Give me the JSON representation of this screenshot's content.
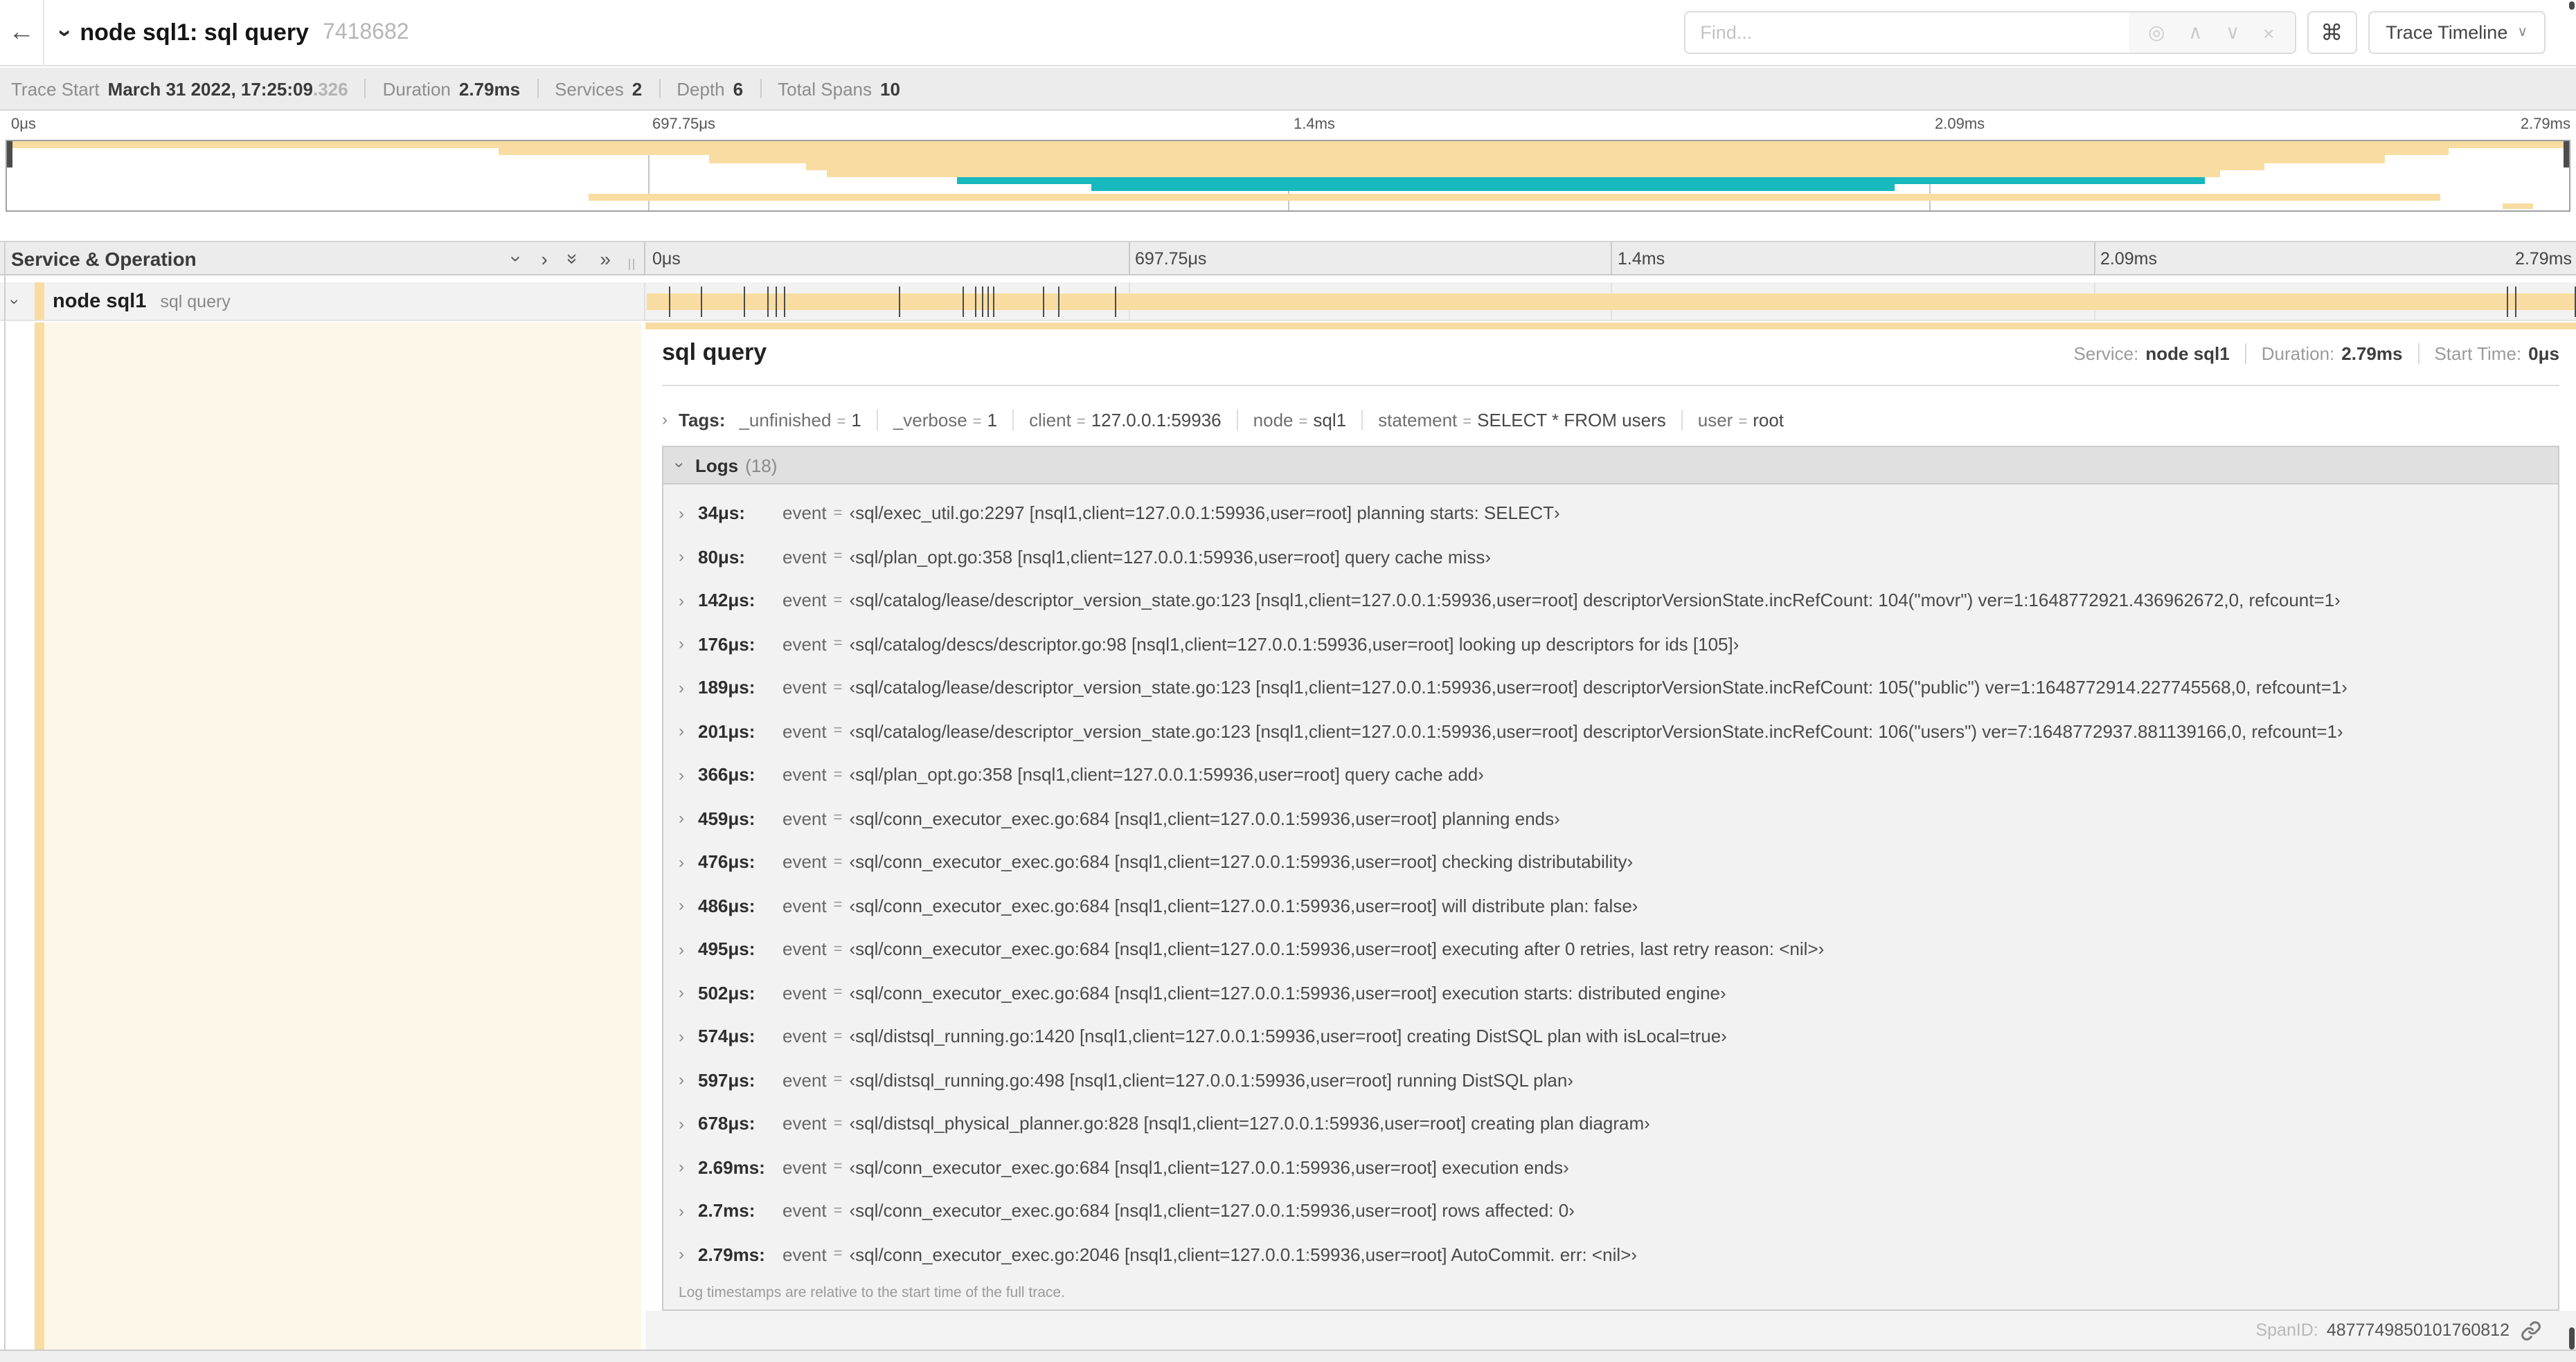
{
  "colors": {
    "service_node_sql1": "#F8DCA1",
    "service_other": "#17B8BE",
    "cream_tint": "rgba(248,220,161,0.24)"
  },
  "header": {
    "back": "←",
    "title": "node sql1: sql query",
    "trace_id": "7418682",
    "find_placeholder": "Find...",
    "cmd_label": "⌘",
    "view_dropdown_label": "Trace Timeline"
  },
  "meta_items": [
    {
      "label": "Trace Start",
      "value": "March 31 2022, 17:25:09",
      "suffix": ".326"
    },
    {
      "label": "Duration",
      "value": "2.79ms"
    },
    {
      "label": "Services",
      "value": "2"
    },
    {
      "label": "Depth",
      "value": "6"
    },
    {
      "label": "Total Spans",
      "value": "10"
    }
  ],
  "time_ticks": [
    "0μs",
    "697.75μs",
    "1.4ms",
    "2.09ms",
    "2.79ms"
  ],
  "minimap_rows": [
    {
      "start": 0.0,
      "end": 1.0,
      "service": "node_sql1",
      "row": 0
    },
    {
      "start": 0.192,
      "end": 0.953,
      "service": "node_sql1",
      "row": 1
    },
    {
      "start": 0.274,
      "end": 0.928,
      "service": "node_sql1",
      "row": 2
    },
    {
      "start": 0.312,
      "end": 0.881,
      "service": "node_sql1",
      "row": 3
    },
    {
      "start": 0.32,
      "end": 0.864,
      "service": "node_sql1",
      "row": 4
    },
    {
      "start": 0.371,
      "end": 0.858,
      "service": "other",
      "row": 5
    },
    {
      "start": 0.423,
      "end": 0.737,
      "service": "other",
      "row": 6
    },
    {
      "start": 0.227,
      "end": 0.95,
      "service": "node_sql1",
      "row": 7.3
    },
    {
      "start": 0.974,
      "end": 0.986,
      "service": "node_sql1",
      "row": 8.6
    }
  ],
  "tree": {
    "header": "Service & Operation",
    "row": {
      "service": "node sql1",
      "operation": "sql query"
    }
  },
  "trace_duration_us": 2790,
  "span_log_marker_times_us": [
    34,
    80,
    142,
    176,
    189,
    201,
    366,
    459,
    476,
    486,
    495,
    502,
    574,
    597,
    678,
    2690,
    2702,
    2788
  ],
  "detail": {
    "operation": "sql query",
    "meta": [
      {
        "label": "Service:",
        "value": "node sql1"
      },
      {
        "label": "Duration:",
        "value": "2.79ms"
      },
      {
        "label": "Start Time:",
        "value": "0μs"
      }
    ],
    "tags_label": "Tags:",
    "tags": [
      {
        "key": "_unfinished",
        "value": "1"
      },
      {
        "key": "_verbose",
        "value": "1"
      },
      {
        "key": "client",
        "value": "127.0.0.1:59936"
      },
      {
        "key": "node",
        "value": "sql1"
      },
      {
        "key": "statement",
        "value": "SELECT * FROM users"
      },
      {
        "key": "user",
        "value": "root"
      }
    ],
    "logs_label": "Logs",
    "logs_count": "(18)",
    "logs": [
      {
        "time": "34μs:",
        "field": "event",
        "value": "‹sql/exec_util.go:2297 [nsql1,client=127.0.0.1:59936,user=root] planning starts: SELECT›"
      },
      {
        "time": "80μs:",
        "field": "event",
        "value": "‹sql/plan_opt.go:358 [nsql1,client=127.0.0.1:59936,user=root] query cache miss›"
      },
      {
        "time": "142μs:",
        "field": "event",
        "value": "‹sql/catalog/lease/descriptor_version_state.go:123 [nsql1,client=127.0.0.1:59936,user=root] descriptorVersionState.incRefCount: 104(\"movr\") ver=1:1648772921.436962672,0, refcount=1›"
      },
      {
        "time": "176μs:",
        "field": "event",
        "value": "‹sql/catalog/descs/descriptor.go:98 [nsql1,client=127.0.0.1:59936,user=root] looking up descriptors for ids [105]›"
      },
      {
        "time": "189μs:",
        "field": "event",
        "value": "‹sql/catalog/lease/descriptor_version_state.go:123 [nsql1,client=127.0.0.1:59936,user=root] descriptorVersionState.incRefCount: 105(\"public\") ver=1:1648772914.227745568,0, refcount=1›"
      },
      {
        "time": "201μs:",
        "field": "event",
        "value": "‹sql/catalog/lease/descriptor_version_state.go:123 [nsql1,client=127.0.0.1:59936,user=root] descriptorVersionState.incRefCount: 106(\"users\") ver=7:1648772937.881139166,0, refcount=1›"
      },
      {
        "time": "366μs:",
        "field": "event",
        "value": "‹sql/plan_opt.go:358 [nsql1,client=127.0.0.1:59936,user=root] query cache add›"
      },
      {
        "time": "459μs:",
        "field": "event",
        "value": "‹sql/conn_executor_exec.go:684 [nsql1,client=127.0.0.1:59936,user=root] planning ends›"
      },
      {
        "time": "476μs:",
        "field": "event",
        "value": "‹sql/conn_executor_exec.go:684 [nsql1,client=127.0.0.1:59936,user=root] checking distributability›"
      },
      {
        "time": "486μs:",
        "field": "event",
        "value": "‹sql/conn_executor_exec.go:684 [nsql1,client=127.0.0.1:59936,user=root] will distribute plan: false›"
      },
      {
        "time": "495μs:",
        "field": "event",
        "value": "‹sql/conn_executor_exec.go:684 [nsql1,client=127.0.0.1:59936,user=root] executing after 0 retries, last retry reason: <nil>›"
      },
      {
        "time": "502μs:",
        "field": "event",
        "value": "‹sql/conn_executor_exec.go:684 [nsql1,client=127.0.0.1:59936,user=root] execution starts: distributed engine›"
      },
      {
        "time": "574μs:",
        "field": "event",
        "value": "‹sql/distsql_running.go:1420 [nsql1,client=127.0.0.1:59936,user=root] creating DistSQL plan with isLocal=true›"
      },
      {
        "time": "597μs:",
        "field": "event",
        "value": "‹sql/distsql_running.go:498 [nsql1,client=127.0.0.1:59936,user=root] running DistSQL plan›"
      },
      {
        "time": "678μs:",
        "field": "event",
        "value": "‹sql/distsql_physical_planner.go:828 [nsql1,client=127.0.0.1:59936,user=root] creating plan diagram›"
      },
      {
        "time": "2.69ms:",
        "field": "event",
        "value": "‹sql/conn_executor_exec.go:684 [nsql1,client=127.0.0.1:59936,user=root] execution ends›"
      },
      {
        "time": "2.7ms:",
        "field": "event",
        "value": "‹sql/conn_executor_exec.go:684 [nsql1,client=127.0.0.1:59936,user=root] rows affected: 0›"
      },
      {
        "time": "2.79ms:",
        "field": "event",
        "value": "‹sql/conn_executor_exec.go:2046 [nsql1,client=127.0.0.1:59936,user=root] AutoCommit. err: <nil>›"
      }
    ],
    "note": "Log timestamps are relative to the start time of the full trace.",
    "spanid_label": "SpanID:",
    "spanid": "4877749850101760812"
  }
}
